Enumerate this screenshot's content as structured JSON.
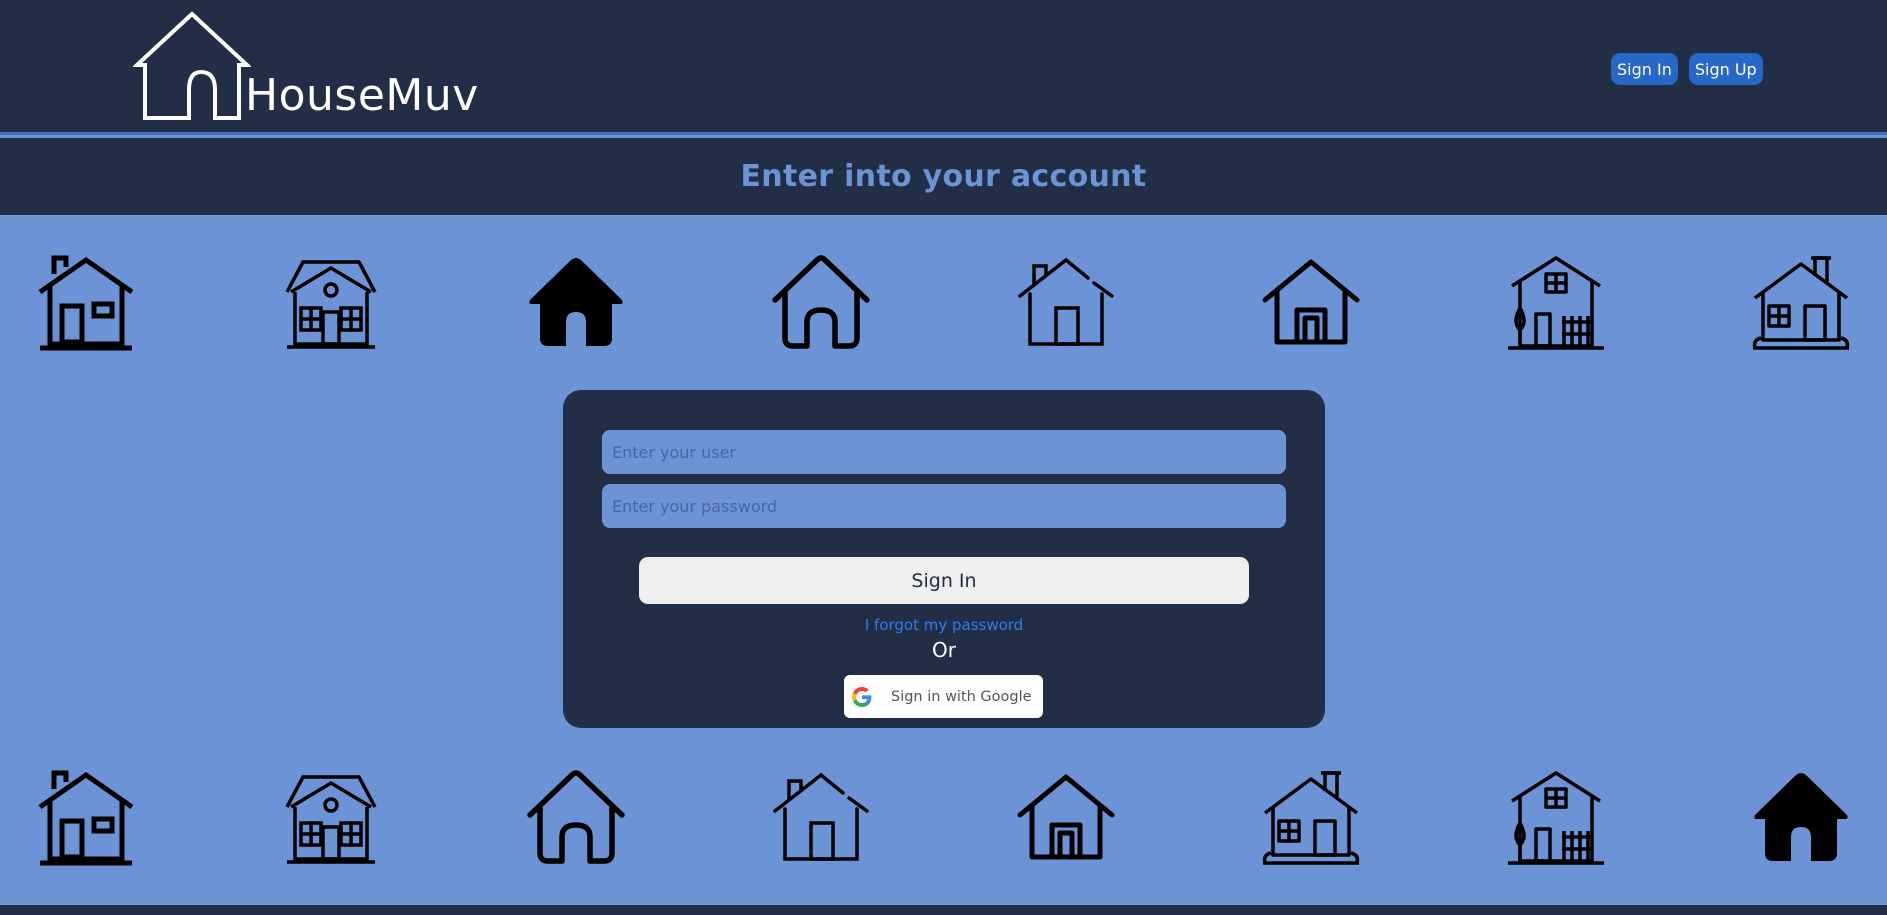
{
  "header": {
    "brand_name": "HouseMuv",
    "logo_icon": "house-outline-logo",
    "nav": [
      {
        "label": "Sign In"
      },
      {
        "label": "Sign Up"
      }
    ]
  },
  "subheader": {
    "title": "Enter into your account"
  },
  "house_rows": {
    "top": [
      "house-chimney-window-icon",
      "house-two-story-icon",
      "house-solid-icon",
      "house-arch-door-icon",
      "house-broken-outline-icon",
      "house-square-door-icon",
      "house-fence-tree-icon",
      "house-bushes-icon"
    ],
    "bottom": [
      "house-chimney-window-icon",
      "house-two-story-icon",
      "house-arch-door-icon",
      "house-broken-outline-icon",
      "house-square-door-icon",
      "house-bushes-icon",
      "house-fence-tree-icon",
      "house-solid-icon"
    ]
  },
  "login": {
    "user_placeholder": "Enter your user",
    "password_placeholder": "Enter your password",
    "signin_label": "Sign In",
    "forgot_label": "I forgot my password",
    "or_label": "Or",
    "google_label": "Sign in with Google"
  },
  "colors": {
    "dark": "#222e45",
    "light_blue": "#6b93d6",
    "nav_button": "#2767c9",
    "link": "#2f7bf0"
  }
}
